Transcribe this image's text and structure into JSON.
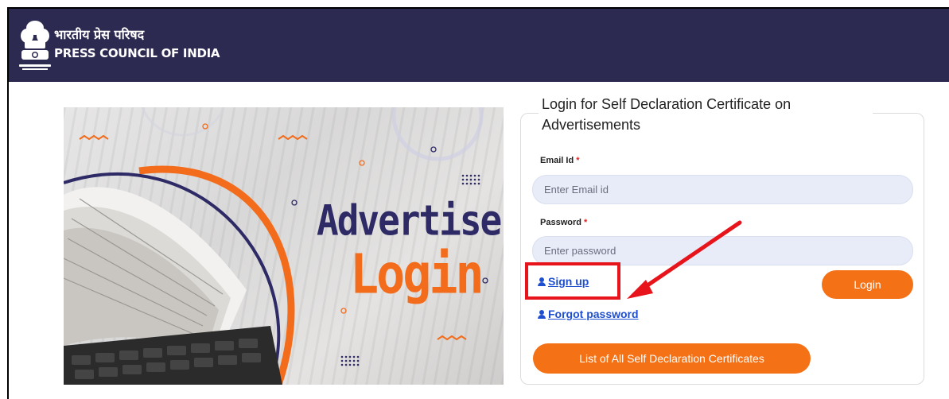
{
  "header": {
    "hindi_name": "भारतीय प्रेस परिषद",
    "english_name": "PRESS COUNCIL OF INDIA"
  },
  "banner": {
    "line1": "Advertiser",
    "line2": "Login"
  },
  "form": {
    "title": "Login for Self Declaration Certificate on Advertisements",
    "email_label": "Email Id",
    "email_placeholder": "Enter Email id",
    "password_label": "Password",
    "password_placeholder": "Enter password",
    "required_mark": "*",
    "signup_label": "Sign up",
    "forgot_label": "Forgot password",
    "login_label": "Login",
    "list_label": "List of All Self Declaration Certificates"
  },
  "colors": {
    "header_bg": "#2c2a50",
    "accent_orange": "#f57116",
    "link_blue": "#1f4fd1",
    "highlight_red": "#e8141b"
  },
  "icons": [
    "emblem-icon",
    "user-icon",
    "arrow-icon"
  ]
}
